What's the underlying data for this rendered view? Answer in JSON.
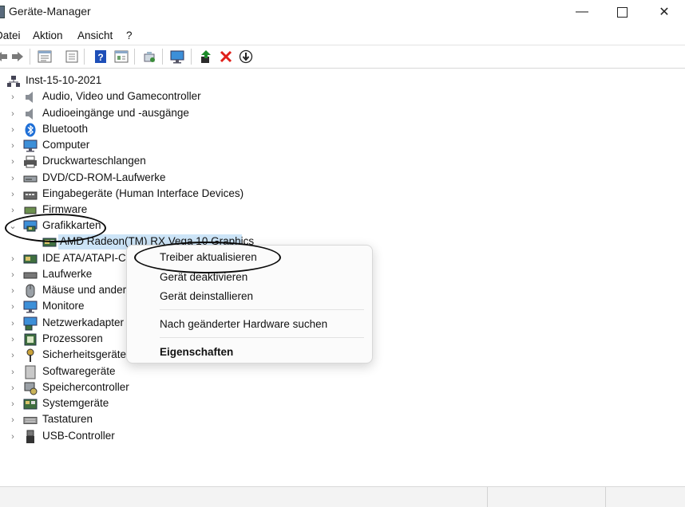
{
  "window": {
    "title": "Geräte-Manager",
    "controls": {
      "minimize": "—",
      "maximize": "",
      "close": "✕"
    }
  },
  "menubar": {
    "items": [
      "Datei",
      "Aktion",
      "Ansicht",
      "?"
    ]
  },
  "toolbar": {
    "icons": [
      "back-arrow-icon",
      "forward-arrow-icon",
      "properties-icon",
      "list-view-icon",
      "help-icon",
      "action-view-icon",
      "scan-icon",
      "monitor-icon",
      "update-driver-icon",
      "uninstall-icon",
      "disable-icon"
    ],
    "colors": {
      "help": "#1e4fb8",
      "uninstall": "#e0201a",
      "green": "#1d8a2a"
    }
  },
  "tree": {
    "root": "Inst-15-10-2021",
    "categories": [
      {
        "label": "Audio, Video und Gamecontroller",
        "icon": "speaker-icon",
        "expanded": false
      },
      {
        "label": "Audioeingänge und -ausgänge",
        "icon": "speaker-icon",
        "expanded": false
      },
      {
        "label": "Bluetooth",
        "icon": "bluetooth-icon",
        "expanded": false
      },
      {
        "label": "Computer",
        "icon": "monitor-icon",
        "expanded": false
      },
      {
        "label": "Druckwarteschlangen",
        "icon": "printer-icon",
        "expanded": false
      },
      {
        "label": "DVD/CD-ROM-Laufwerke",
        "icon": "dvd-drive-icon",
        "expanded": false
      },
      {
        "label": "Eingabegeräte (Human Interface Devices)",
        "icon": "hid-icon",
        "expanded": false
      },
      {
        "label": "Firmware",
        "icon": "chip-icon",
        "expanded": false
      },
      {
        "label": "Grafikkarten",
        "icon": "display-adapter-icon",
        "expanded": true
      },
      {
        "label": "IDE ATA/ATAPI-Cor",
        "icon": "ide-icon",
        "expanded": false
      },
      {
        "label": "Laufwerke",
        "icon": "disk-drive-icon",
        "expanded": false
      },
      {
        "label": "Mäuse und ander",
        "icon": "mouse-icon",
        "expanded": false
      },
      {
        "label": "Monitore",
        "icon": "monitor-icon",
        "expanded": false
      },
      {
        "label": "Netzwerkadapter",
        "icon": "network-adapter-icon",
        "expanded": false
      },
      {
        "label": "Prozessoren",
        "icon": "processor-icon",
        "expanded": false
      },
      {
        "label": "Sicherheitsgeräte",
        "icon": "key-icon",
        "expanded": false
      },
      {
        "label": "Softwaregeräte",
        "icon": "software-device-icon",
        "expanded": false
      },
      {
        "label": "Speichercontroller",
        "icon": "storage-controller-icon",
        "expanded": false
      },
      {
        "label": "Systemgeräte",
        "icon": "system-devices-icon",
        "expanded": false
      },
      {
        "label": "Tastaturen",
        "icon": "keyboard-icon",
        "expanded": false
      },
      {
        "label": "USB-Controller",
        "icon": "usb-icon",
        "expanded": false
      }
    ],
    "selected_child": "AMD Radeon(TM) RX Vega 10 Graphics"
  },
  "context_menu": {
    "items": [
      "Treiber aktualisieren",
      "Gerät deaktivieren",
      "Gerät deinstallieren",
      "Nach geänderter Hardware suchen",
      "Eigenschaften"
    ]
  },
  "colors": {
    "selection": "#cce4f7",
    "annotation": "#0b0b0b"
  }
}
